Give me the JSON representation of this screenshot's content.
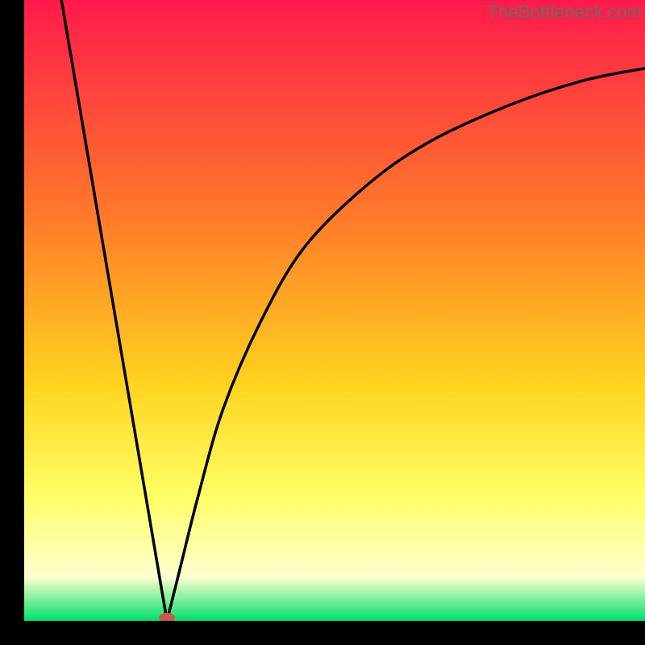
{
  "watermark": "TheBottleneck.com",
  "colors": {
    "gradient_top": "#ff1a4b",
    "gradient_mid_upper": "#ff7a2a",
    "gradient_mid": "#ffd41f",
    "gradient_mid_lower": "#ffff66",
    "gradient_low": "#fdffd0",
    "gradient_bottom": "#00e06a",
    "curve": "#000000",
    "marker": "#c85a50",
    "frame": "#000000"
  },
  "chart_data": {
    "type": "line",
    "title": "",
    "xlabel": "",
    "ylabel": "",
    "xlim": [
      0,
      100
    ],
    "ylim": [
      0,
      100
    ],
    "min_point": {
      "x": 23,
      "y": 0
    },
    "segments": [
      {
        "name": "left-descent",
        "kind": "line",
        "from": {
          "x": 6,
          "y": 100
        },
        "to": {
          "x": 23,
          "y": 0
        }
      },
      {
        "name": "right-ascent",
        "kind": "curve",
        "points": [
          {
            "x": 23,
            "y": 0
          },
          {
            "x": 25,
            "y": 8
          },
          {
            "x": 28,
            "y": 20
          },
          {
            "x": 32,
            "y": 34
          },
          {
            "x": 38,
            "y": 48
          },
          {
            "x": 45,
            "y": 60
          },
          {
            "x": 55,
            "y": 70
          },
          {
            "x": 65,
            "y": 77
          },
          {
            "x": 78,
            "y": 83
          },
          {
            "x": 90,
            "y": 87
          },
          {
            "x": 100,
            "y": 89
          }
        ]
      }
    ],
    "marker": {
      "x": 23,
      "y": 0,
      "color": "#c85a50"
    }
  }
}
